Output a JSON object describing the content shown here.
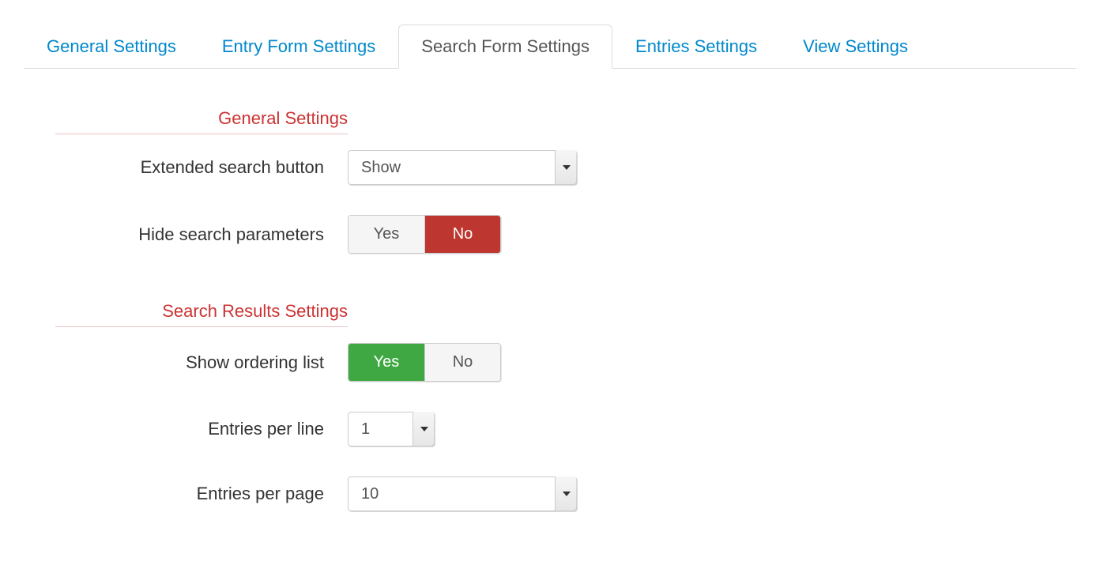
{
  "tabs": {
    "general": "General Settings",
    "entry_form": "Entry Form Settings",
    "search_form": "Search Form Settings",
    "entries": "Entries Settings",
    "view": "View Settings"
  },
  "sections": {
    "general": {
      "heading": "General Settings",
      "fields": {
        "extended_search_button": {
          "label": "Extended search button",
          "value": "Show"
        },
        "hide_search_parameters": {
          "label": "Hide search parameters",
          "yes": "Yes",
          "no": "No",
          "selected": "No"
        }
      }
    },
    "results": {
      "heading": "Search Results Settings",
      "fields": {
        "show_ordering_list": {
          "label": "Show ordering list",
          "yes": "Yes",
          "no": "No",
          "selected": "Yes"
        },
        "entries_per_line": {
          "label": "Entries per line",
          "value": "1"
        },
        "entries_per_page": {
          "label": "Entries per page",
          "value": "10"
        }
      }
    }
  }
}
